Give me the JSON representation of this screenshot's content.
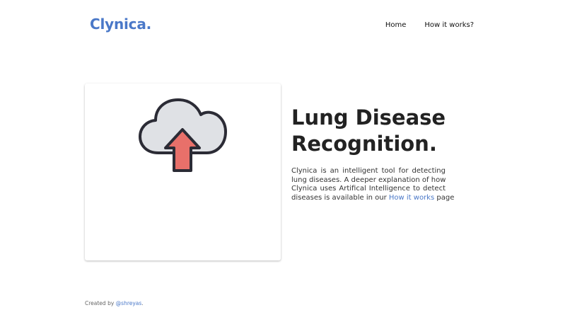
{
  "header": {
    "brand": "Clynica.",
    "nav": [
      {
        "label": "Home"
      },
      {
        "label": "How it works?"
      }
    ]
  },
  "upload": {
    "icon": "cloud-upload-icon",
    "colors": {
      "cloud_fill": "#dfe1e5",
      "outline": "#2b2b35",
      "arrow": "#e8706a"
    }
  },
  "hero": {
    "title_line1": "Lung Disease",
    "title_line2": "Recognition.",
    "desc_line1": "Clynica is an intelligent tool for detecting",
    "desc_line2": "lung diseases. A deeper explanation of how",
    "desc_line3": "Clynica uses Artifical Intelligence to detect",
    "desc_line4_prefix": "diseases is available in our ",
    "desc_link": "How it works",
    "desc_line4_suffix": " page"
  },
  "footer": {
    "prefix": "Created by ",
    "link": "@shreyas",
    "suffix": "."
  },
  "theme": {
    "accent": "#4a78c8",
    "text": "#222222"
  }
}
